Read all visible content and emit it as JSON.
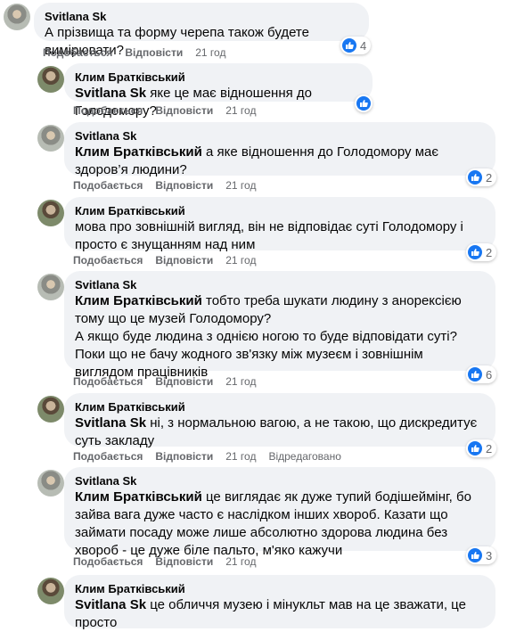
{
  "actions": {
    "like": "Подобається",
    "reply": "Відповісти",
    "edited": "Відредаговано"
  },
  "comments": [
    {
      "author": "Svitlana Sk",
      "text": "А прізвища та форму черепа також будете вимірювати?",
      "time": "21 год",
      "reactions": "4"
    },
    {
      "author": "Клим Братківський",
      "mention": "Svitlana Sk",
      "text": " яке це має відношення до Голодомору?",
      "time": "21 год",
      "reactions": ""
    },
    {
      "author": "Svitlana Sk",
      "mention": "Клим Братківський",
      "text": " а яке відношення до Голодомору має здоров’я людини?",
      "time": "21 год",
      "reactions": "2"
    },
    {
      "author": "Клим Братківський",
      "text": "мова про зовнішній вигляд, він не відповідає суті Голодомору і просто є знущанням над ним",
      "time": "21 год",
      "reactions": "2"
    },
    {
      "author": "Svitlana Sk",
      "mention": "Клим Братківський",
      "text": " тобто треба шукати людину з анорексією тому що це музей Голодомору?",
      "text2": "А якщо буде людина з однією ногою то буде відповідати суті?",
      "text3": "Поки що не бачу жодного зв'язку між музеєм і зовнішнім виглядом працівників",
      "time": "21 год",
      "reactions": "6"
    },
    {
      "author": "Клим Братківський",
      "mention": "Svitlana Sk",
      "text": " ні, з нормальною вагою, а не такою, що дискредитує суть закладу",
      "time": "21 год",
      "reactions": "2"
    },
    {
      "author": "Svitlana Sk",
      "mention": "Клим Братківський",
      "text": " це виглядає як дуже тупий бодішеймінг, бо зайва вага дуже часто є наслідком інших хвороб. Казати що займати посаду може лише абсолютно здорова людина без хвороб - це дуже біле пальто, м'яко кажучи",
      "time": "21 год",
      "reactions": "3"
    },
    {
      "author": "Клим Братківський",
      "mention": "Svitlana Sk",
      "text": " це обличчя музею і мінукльт мав на це зважати, це просто",
      "time": "",
      "reactions": ""
    }
  ]
}
